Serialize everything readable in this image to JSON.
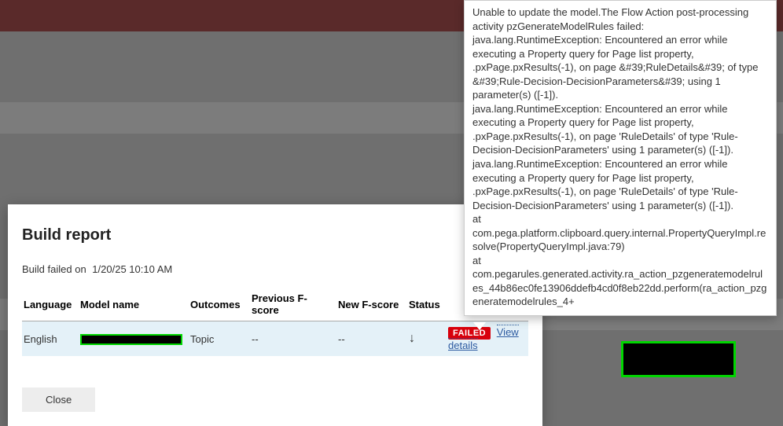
{
  "modal": {
    "title": "Build report",
    "status_prefix": "Build failed on",
    "status_time": "1/20/25 10:10 AM",
    "close_label": "Close"
  },
  "table": {
    "headers": {
      "language": "Language",
      "model_name": "Model name",
      "outcomes": "Outcomes",
      "prev_f": "Previous F-score",
      "new_f": "New F-score",
      "status": "Status"
    },
    "rows": [
      {
        "language": "English",
        "model_name": "[redacted]",
        "outcomes": "Topic",
        "prev_f": "--",
        "new_f": "--",
        "status_badge": "FAILED",
        "details_link": "View details"
      }
    ]
  },
  "tooltip": {
    "text": "Unable to update the model.The Flow Action post-processing activity pzGenerateModelRules failed: java.lang.RuntimeException: Encountered an error while executing a Property query for Page list property, .pxPage.pxResults(-1), on page &#39;RuleDetails&#39; of type &#39;Rule-Decision-DecisionParameters&#39; using 1 parameter(s) ([-1]).\njava.lang.RuntimeException: Encountered an error while executing a Property query for Page list property, .pxPage.pxResults(-1), on page 'RuleDetails' of type 'Rule-Decision-DecisionParameters' using 1 parameter(s) ([-1]). java.lang.RuntimeException: Encountered an error while executing a Property query for Page list property, .pxPage.pxResults(-1), on page 'RuleDetails' of type 'Rule-Decision-DecisionParameters' using 1 parameter(s) ([-1]).\nat com.pega.platform.clipboard.query.internal.PropertyQueryImpl.resolve(PropertyQueryImpl.java:79)\nat com.pegarules.generated.activity.ra_action_pzgeneratemodelrules_44b86ec0fe13906ddefb4cd0f8eb22dd.perform(ra_action_pzgeneratemodelrules_4+"
  }
}
